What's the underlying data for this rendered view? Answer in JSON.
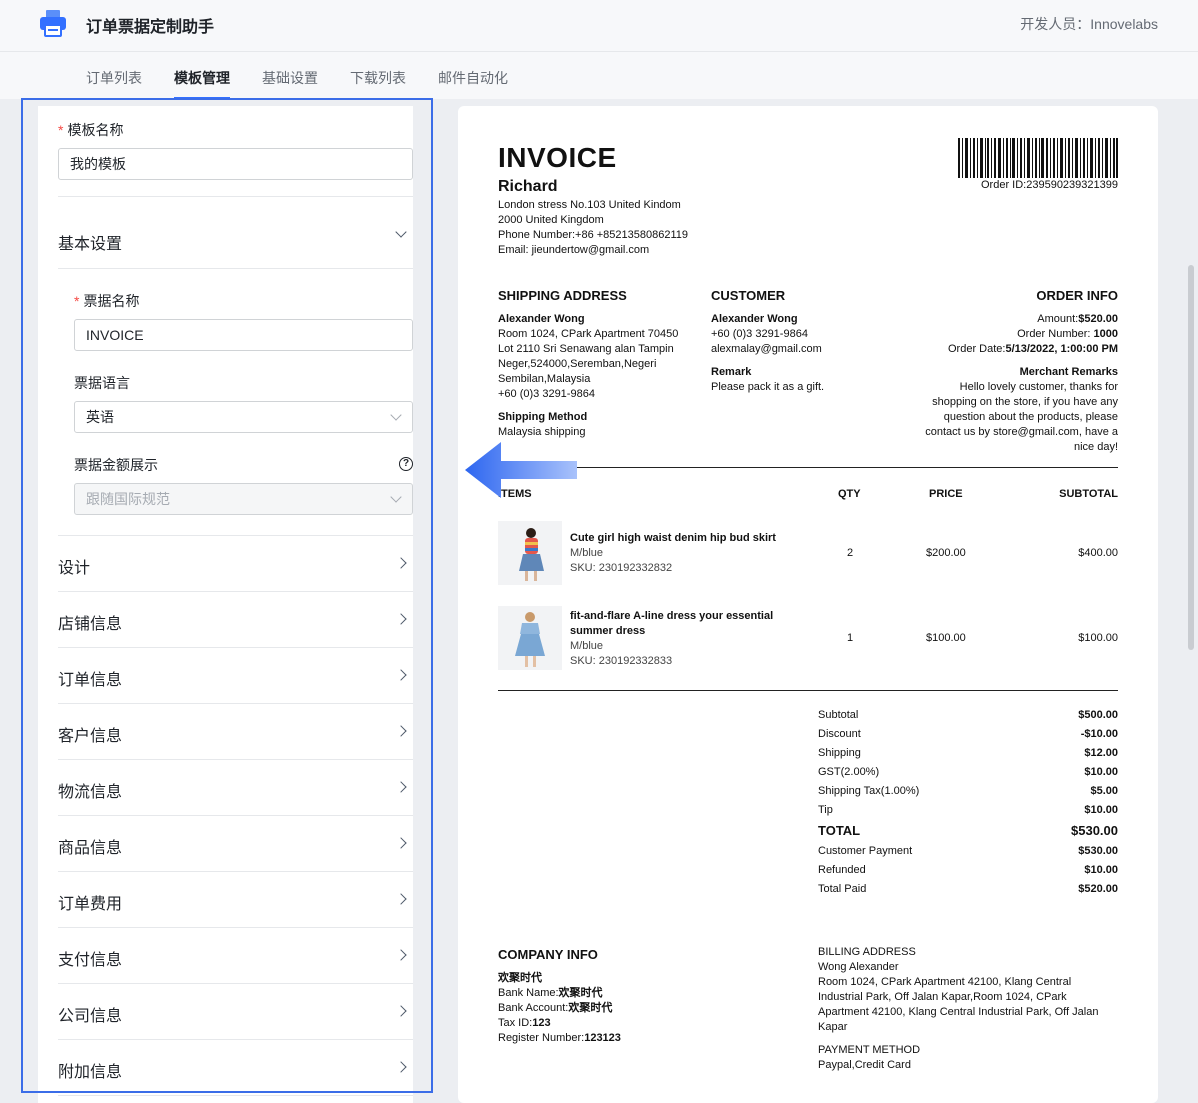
{
  "header": {
    "app_title": "订单票据定制助手",
    "developer": "开发人员：Innovelabs"
  },
  "tabs": [
    {
      "label": "订单列表",
      "active": false
    },
    {
      "label": "模板管理",
      "active": true
    },
    {
      "label": "基础设置",
      "active": false
    },
    {
      "label": "下载列表",
      "active": false
    },
    {
      "label": "邮件自动化",
      "active": false
    }
  ],
  "settings": {
    "template_name_label": "模板名称",
    "template_name_value": "我的模板",
    "basic_settings_title": "基本设置",
    "invoice_name_label": "票据名称",
    "invoice_name_value": "INVOICE",
    "invoice_language_label": "票据语言",
    "invoice_language_value": "英语",
    "amount_display_label": "票据金额展示",
    "amount_display_placeholder": "跟随国际规范",
    "sections": [
      "设计",
      "店铺信息",
      "订单信息",
      "客户信息",
      "物流信息",
      "商品信息",
      "订单费用",
      "支付信息",
      "公司信息",
      "附加信息"
    ]
  },
  "invoice": {
    "title": "INVOICE",
    "store_name": "Richard",
    "store_address1": "London stress No.103 United Kindom",
    "store_address2": "2000 United Kingdom",
    "store_phone": "Phone Number:+86 +85213580862119",
    "store_email": "Email: jieundertow@gmail.com",
    "order_id": "Order ID:239590239321399",
    "shipping": {
      "heading": "SHIPPING ADDRESS",
      "name": "Alexander Wong",
      "line1": "Room 1024, CPark Apartment 70450",
      "line2": "Lot 2110 Sri Senawang alan Tampin",
      "line3": "Neger,524000,Seremban,Negeri",
      "line4": "Sembilan,Malaysia",
      "phone": "+60 (0)3 3291-9864",
      "method_label": "Shipping Method",
      "method_value": "Malaysia shipping"
    },
    "customer": {
      "heading": "CUSTOMER",
      "name": "Alexander Wong",
      "phone": "+60 (0)3 3291-9864",
      "email": "alexmalay@gmail.com",
      "remark_label": "Remark",
      "remark_value": "Please pack it as a gift."
    },
    "order_info": {
      "heading": "ORDER INFO",
      "amount_label": "Amount:",
      "amount_value": "$520.00",
      "number_label": "Order Number: ",
      "number_value": "1000",
      "date_label": "Order Date:",
      "date_value": "5/13/2022, 1:00:00 PM",
      "remarks_label": "Merchant Remarks",
      "remarks_line1": "Hello lovely customer, thanks for",
      "remarks_line2": "shopping on the store, if you have any",
      "remarks_line3": "question about the products, please",
      "remarks_line4": "contact us by store@gmail.com, have a",
      "remarks_line5": "nice day!"
    },
    "items_header": {
      "items": "ITEMS",
      "qty": "QTY",
      "price": "PRICE",
      "subtotal": "SUBTOTAL"
    },
    "items": [
      {
        "name1": "Cute girl high waist denim hip bud skirt",
        "name2": "",
        "variant": "M/blue",
        "sku": "SKU: 230192332832",
        "qty": "2",
        "price": "$200.00",
        "subtotal": "$400.00"
      },
      {
        "name1": "fit-and-flare A-line dress your essential",
        "name2": "summer dress",
        "variant": "M/blue",
        "sku": "SKU: 230192332833",
        "qty": "1",
        "price": "$100.00",
        "subtotal": "$100.00"
      }
    ],
    "totals": [
      {
        "label": "Subtotal",
        "value": "$500.00"
      },
      {
        "label": "Discount",
        "value": "-$10.00"
      },
      {
        "label": "Shipping",
        "value": "$12.00"
      },
      {
        "label": "GST(2.00%)",
        "value": "$10.00"
      },
      {
        "label": "Shipping Tax(1.00%)",
        "value": "$5.00"
      },
      {
        "label": "Tip",
        "value": "$10.00"
      },
      {
        "label": "TOTAL",
        "value": "$530.00"
      },
      {
        "label": "Customer Payment",
        "value": "$530.00"
      },
      {
        "label": "Refunded",
        "value": "$10.00"
      },
      {
        "label": "Total Paid",
        "value": "$520.00"
      }
    ],
    "company": {
      "heading": "COMPANY INFO",
      "name": "欢聚时代",
      "bank_name_label": "Bank Name:",
      "bank_name_value": "欢聚时代",
      "bank_account_label": "Bank Account:",
      "bank_account_value": "欢聚时代",
      "tax_label": "Tax ID:",
      "tax_value": "123",
      "register_label": "Register Number:",
      "register_value": "123123"
    },
    "billing": {
      "heading": "BILLING ADDRESS",
      "name": "Wong Alexander",
      "line1": "Room 1024, CPark Apartment 42100, Klang Central",
      "line2": "Industrial Park, Off Jalan Kapar,Room 1024, CPark",
      "line3": "Apartment 42100, Klang Central Industrial Park, Off Jalan",
      "line4": "Kapar",
      "payment_heading": "PAYMENT METHOD",
      "payment_value": "Paypal,Credit Card"
    }
  },
  "colors": {
    "accent": "#3370ff",
    "panel_border": "#3b6de8",
    "required": "#f54a45"
  }
}
